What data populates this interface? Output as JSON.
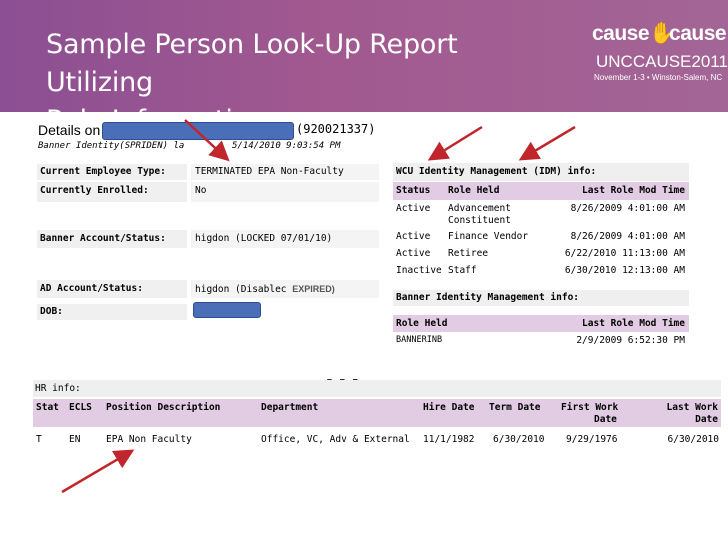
{
  "slide": {
    "title_line1": "Sample Person Look-Up Report Utilizing",
    "title_line2": "Role Information",
    "logo": {
      "brand_left": "cause",
      "brand_right": "cause",
      "conference": "UNCCAUSE2011",
      "dates": "November 1-3 • Winston-Salem, NC"
    },
    "ellipsis": "..."
  },
  "details": {
    "title": "Details on",
    "id": "(920021337)",
    "identity_label": "Banner Identity(SPRIDEN) la",
    "identity_date": "5/14/2010 9:03:54 PM"
  },
  "person_fields": [
    {
      "label": "Current Employee Type:",
      "value": "TERMINATED EPA Non-Faculty (Staff)"
    },
    {
      "label": "Currently Enrolled:",
      "value": "No"
    },
    {
      "label": "Banner Account/Status:",
      "value": "higdon (LOCKED 07/01/10)"
    },
    {
      "label": "AD Account/Status:",
      "value": "higdon (Disablec",
      "value_suffix": "EXPIRED)"
    },
    {
      "label": "DOB:",
      "value": ""
    }
  ],
  "idm": {
    "title": "WCU Identity Management (IDM) info:",
    "columns": [
      "Status",
      "Role Held",
      "Last Role Mod Time"
    ],
    "rows": [
      {
        "status": "Active",
        "role": "Advancement",
        "role2": "Constituent",
        "time": "8/26/2009 4:01:00 AM"
      },
      {
        "status": "Active",
        "role": "Finance Vendor",
        "role2": "",
        "time": "8/26/2009 4:01:00 AM"
      },
      {
        "status": "Active",
        "role": "Retiree",
        "role2": "",
        "time": "6/22/2010 11:13:00 AM"
      },
      {
        "status": "Inactive",
        "role": "Staff",
        "role2": "",
        "time": "6/30/2010 12:13:00 AM"
      }
    ]
  },
  "banner_idm": {
    "title": "Banner Identity Management info:",
    "columns": [
      "Role Held",
      "Last Role Mod Time"
    ],
    "rows": [
      {
        "role": "BANNERINB",
        "time": "2/9/2009 6:52:30 PM"
      }
    ]
  },
  "hr": {
    "title": "HR info:",
    "columns": [
      "Stat",
      "ECLS",
      "Position Description",
      "Department",
      "Hire Date",
      "Term Date",
      "First Work",
      "Date",
      "Last Work",
      "Date"
    ],
    "row": {
      "stat": "T",
      "ecls": "EN",
      "position": "EPA Non Faculty",
      "department": "Office, VC, Adv & External",
      "hire": "11/1/1982",
      "term": "6/30/2010",
      "first_work": "9/29/1976",
      "last_work": "6/30/2010"
    }
  },
  "colors": {
    "header_purple": "#96559a",
    "row_header_lavender": "#e2cce3",
    "redaction_blue": "#4a6fb8",
    "arrow_red": "#c0262b"
  }
}
